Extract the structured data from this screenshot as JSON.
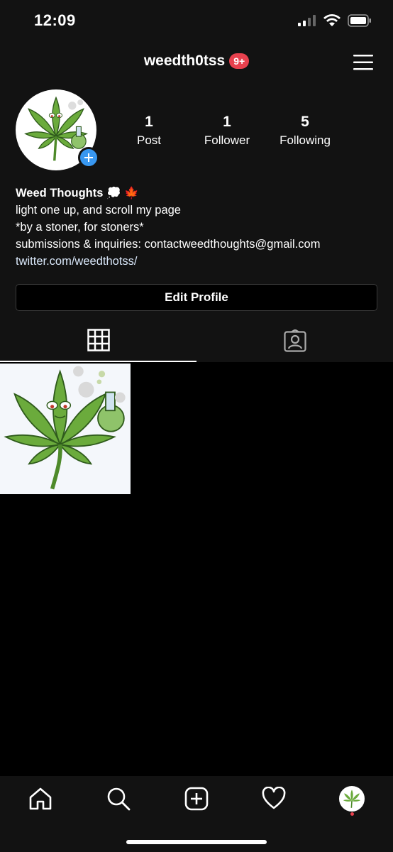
{
  "status_bar": {
    "time": "12:09"
  },
  "header": {
    "username": "weedth0tss",
    "notification_badge": "9+"
  },
  "stats": [
    {
      "count": "1",
      "label": "Post"
    },
    {
      "count": "1",
      "label": "Follower"
    },
    {
      "count": "5",
      "label": "Following"
    }
  ],
  "bio": {
    "name": "Weed Thoughts 💭 🍁",
    "lines": [
      "light one up, and scroll my page",
      "*by a stoner, for stoners*",
      "submissions & inquiries: contactweedthoughts@gmail.com"
    ],
    "link": "twitter.com/weedthotss/"
  },
  "actions": {
    "edit_profile": "Edit Profile"
  },
  "tabs": [
    {
      "icon": "grid-icon"
    },
    {
      "icon": "tagged-icon"
    }
  ],
  "posts": [
    {
      "icon": "cannabis-leaf-cartoon"
    }
  ],
  "bottom_nav": [
    {
      "icon": "home-icon"
    },
    {
      "icon": "search-icon"
    },
    {
      "icon": "add-post-icon"
    },
    {
      "icon": "heart-icon"
    },
    {
      "icon": "profile-avatar"
    }
  ],
  "colors": {
    "background": "#000000",
    "surface": "#121212",
    "badge": "#e8414e",
    "add_button": "#3897f0",
    "leaf": "#6bab3c"
  }
}
